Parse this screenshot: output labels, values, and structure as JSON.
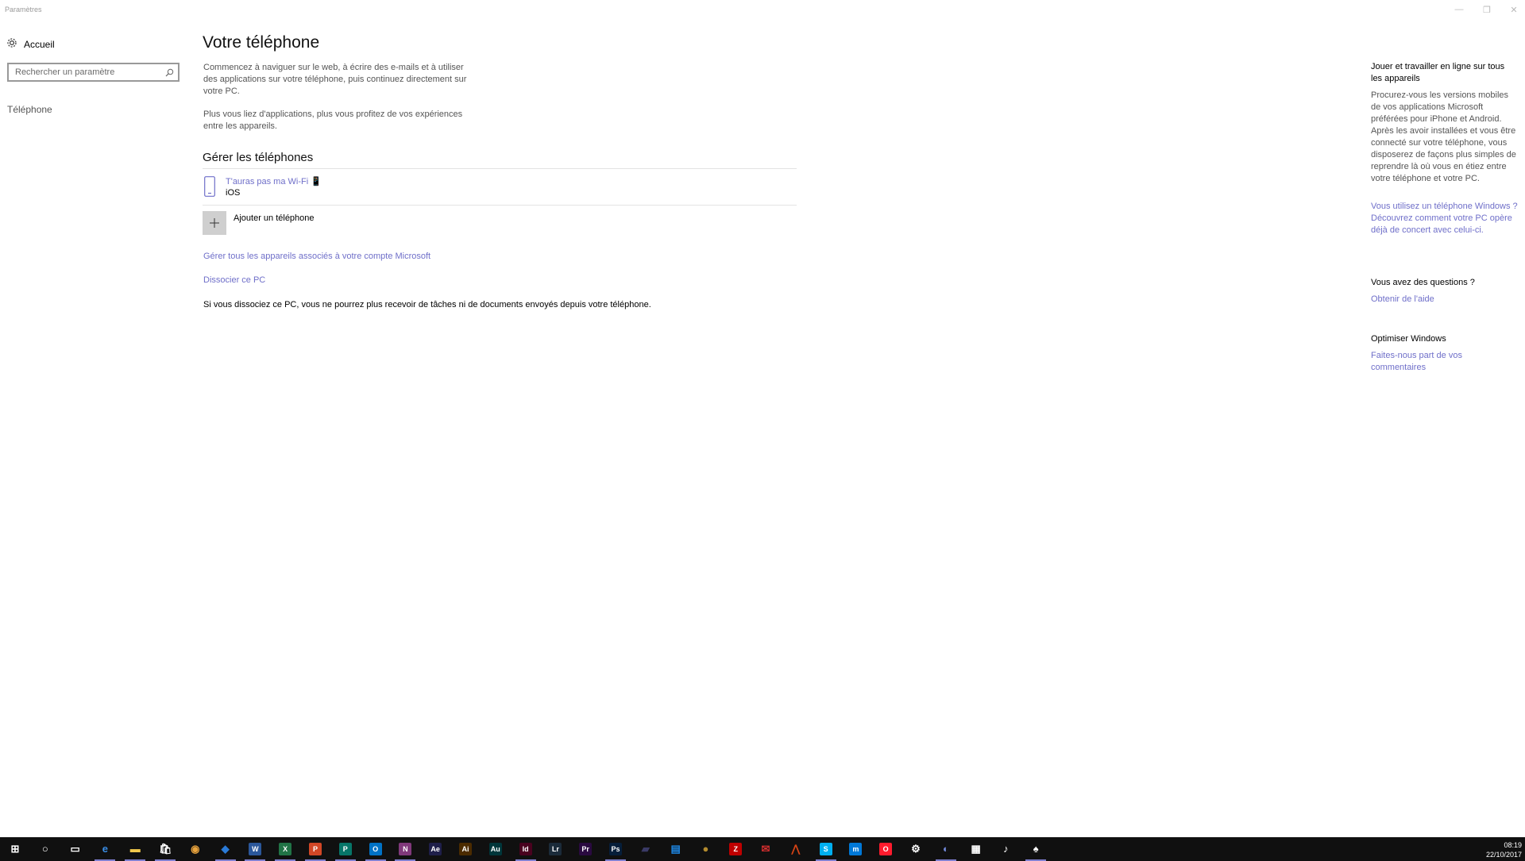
{
  "window": {
    "title": "Paramètres",
    "controls": {
      "minimize": "—",
      "maximize": "❐",
      "close": "✕"
    }
  },
  "sidebar": {
    "home_label": "Accueil",
    "search_placeholder": "Rechercher un paramètre",
    "items": [
      {
        "label": "Téléphone"
      }
    ]
  },
  "main": {
    "title": "Votre téléphone",
    "intro": "Commencez à naviguer sur le web, à écrire des e-mails et à utiliser des applications sur votre téléphone, puis continuez directement sur votre PC.",
    "intro2": "Plus vous liez d'applications, plus vous profitez de vos expériences entre les appareils.",
    "manage_heading": "Gérer les téléphones",
    "phone": {
      "name": "T'auras pas ma Wi-Fi 📱",
      "os": "iOS"
    },
    "add_phone": "Ajouter un téléphone",
    "manage_link": "Gérer tous les appareils associés à votre compte Microsoft",
    "unlink_link": "Dissocier ce PC",
    "unlink_note": "Si vous dissociez ce PC, vous ne pourrez plus recevoir de tâches ni de documents envoyés depuis votre téléphone."
  },
  "right": {
    "section1_title": "Jouer et travailler en ligne sur tous les appareils",
    "section1_text": "Procurez-vous les versions mobiles de vos applications Microsoft préférées pour iPhone et Android. Après les avoir installées et vous être connecté sur votre téléphone, vous disposerez de façons plus simples de reprendre là où vous en étiez entre votre téléphone et votre PC.",
    "section1_link": "Vous utilisez un téléphone Windows ? Découvrez comment votre PC opère déjà de concert avec celui-ci.",
    "section2_title": "Vous avez des questions ?",
    "section2_link": "Obtenir de l'aide",
    "section3_title": "Optimiser Windows",
    "section3_link": "Faites-nous part de vos commentaires"
  },
  "taskbar": {
    "apps": [
      {
        "name": "start",
        "glyph": "⊞",
        "color": "#ffffff"
      },
      {
        "name": "cortana",
        "glyph": "○",
        "color": "#ffffff"
      },
      {
        "name": "task-view",
        "glyph": "▭",
        "color": "#ffffff"
      },
      {
        "name": "edge",
        "glyph": "e",
        "color": "#3a8ee6"
      },
      {
        "name": "file-explorer",
        "glyph": "▬",
        "color": "#f2c94c"
      },
      {
        "name": "store",
        "glyph": "🛍",
        "color": "#ffffff"
      },
      {
        "name": "chrome",
        "glyph": "◉",
        "color": "#e8a33d"
      },
      {
        "name": "app",
        "glyph": "◆",
        "color": "#2a7bd8"
      },
      {
        "name": "word",
        "glyph": "W",
        "color": "#2b579a"
      },
      {
        "name": "excel",
        "glyph": "X",
        "color": "#217346"
      },
      {
        "name": "powerpoint",
        "glyph": "P",
        "color": "#d24726"
      },
      {
        "name": "publisher",
        "glyph": "P",
        "color": "#077568"
      },
      {
        "name": "outlook",
        "glyph": "O",
        "color": "#0072c6"
      },
      {
        "name": "onenote",
        "glyph": "N",
        "color": "#80397b"
      },
      {
        "name": "after-effects",
        "glyph": "Ae",
        "color": "#1f1f4a"
      },
      {
        "name": "illustrator",
        "glyph": "Ai",
        "color": "#4b2b00"
      },
      {
        "name": "audition",
        "glyph": "Au",
        "color": "#00363a"
      },
      {
        "name": "indesign",
        "glyph": "Id",
        "color": "#49021f"
      },
      {
        "name": "lightroom",
        "glyph": "Lr",
        "color": "#1b2b3a"
      },
      {
        "name": "premiere",
        "glyph": "Pr",
        "color": "#2a0a40"
      },
      {
        "name": "photoshop",
        "glyph": "Ps",
        "color": "#061e3a"
      },
      {
        "name": "media-encoder",
        "glyph": "▰",
        "color": "#3a3a66"
      },
      {
        "name": "app-doc",
        "glyph": "▤",
        "color": "#1e88e5"
      },
      {
        "name": "app-owl",
        "glyph": "●",
        "color": "#b38b2e"
      },
      {
        "name": "filezilla",
        "glyph": "Z",
        "color": "#bf0000"
      },
      {
        "name": "mail",
        "glyph": "✉",
        "color": "#d32f2f"
      },
      {
        "name": "app-pen",
        "glyph": "⋀",
        "color": "#d84315"
      },
      {
        "name": "skype",
        "glyph": "S",
        "color": "#00aff0"
      },
      {
        "name": "app-m",
        "glyph": "m",
        "color": "#0078d7"
      },
      {
        "name": "opera",
        "glyph": "O",
        "color": "#ff1b2d"
      },
      {
        "name": "settings",
        "glyph": "⚙",
        "color": "#ffffff"
      },
      {
        "name": "discord",
        "glyph": "◐",
        "color": "#7289da"
      },
      {
        "name": "calculator",
        "glyph": "▦",
        "color": "#ffffff"
      },
      {
        "name": "itunes",
        "glyph": "♪",
        "color": "#ffffff"
      },
      {
        "name": "solitaire",
        "glyph": "♠",
        "color": "#ffffff"
      }
    ],
    "time": "08:19",
    "date": "22/10/2017"
  }
}
